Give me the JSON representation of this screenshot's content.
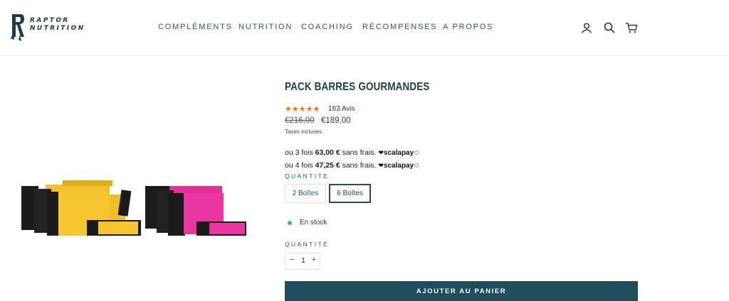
{
  "brand": {
    "logo_mark": "R",
    "logo_line1": "RAPTOR",
    "logo_line2": "NUTRITION"
  },
  "nav": {
    "items": [
      "COMPLÉMENTS",
      "NUTRITION",
      "COACHING",
      "RÉCOMPENSES",
      "A PROPOS"
    ]
  },
  "header_icons": [
    "user-icon",
    "search-icon",
    "cart-icon"
  ],
  "product": {
    "title": "PACK BARRES GOURMANDES",
    "stars": "★★★★★",
    "star_color": "#e8731f",
    "reviews": "183 Avis",
    "old_price": "€216,00",
    "price": "€189,00",
    "tax_note": "Taxes incluses.",
    "installments": [
      {
        "prefix": "ou 3 fois",
        "amount": "63,00 €",
        "suffix": "sans frais.",
        "provider": "scalapay"
      },
      {
        "prefix": "ou 4 fois",
        "amount": "47,25 €",
        "suffix": "sans frais.",
        "provider": "scalapay"
      }
    ],
    "variant_label": "QUANTITE",
    "variants": [
      "2 Boîtes",
      "6 Boîtes"
    ],
    "selected_variant": "6 Boîtes",
    "stock_status": "En stock",
    "stock_color": "#3fbf4a",
    "qty_label": "QUANTITÉ",
    "qty_minus": "−",
    "qty_value": "1",
    "qty_plus": "+",
    "cta": "AJOUTER AU PANIER"
  },
  "colors": {
    "accent": "#1f4e5f",
    "bar_yellow": "#f2c12e",
    "bar_pink": "#e0329a"
  }
}
